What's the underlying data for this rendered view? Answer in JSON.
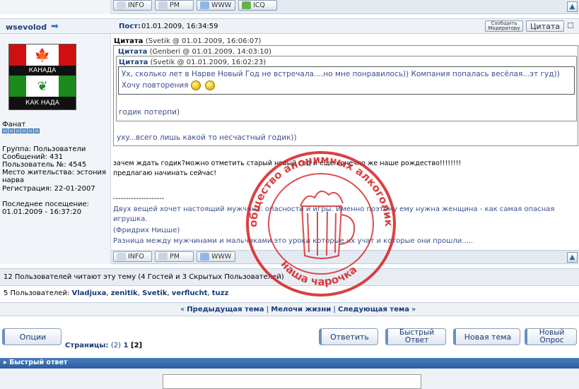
{
  "top_buttons": [
    "INFO",
    "PM",
    "WWW",
    "ICQ"
  ],
  "user": {
    "name": "wsevolod",
    "flag_top": "КАНАДА",
    "flag_bottom": "КАК НАДА",
    "rank": "Фанат",
    "info": [
      "Группа: Пользователи",
      "Сообщений: 431",
      "Пользователь №: 4545",
      "Место жительства: эстония",
      "нарва",
      "Регистрация: 22-01-2007",
      "",
      "Последнее посещение:",
      "01.01.2009 - 16:37:20"
    ]
  },
  "post": {
    "label": "Пост:",
    "date": "01.01.2009, 16:34:59",
    "report": "Сообщить Модератору",
    "quote_btn": "Цитата",
    "q1_head": "Цитата",
    "q1_meta": "(Svetik @ 01.01.2009, 16:06:07)",
    "q2_head": "Цитата",
    "q2_meta": "(Genberi @ 01.01.2009, 14:03:10)",
    "q3_head": "Цитата",
    "q3_meta": "(Svetik @ 01.01.2009, 16:02:23)",
    "q3_line1": "Ух, сколько лет в Нарве Новый Год не встречала....но мне понравилось)) Компания попалась весёлая...эт гуд))",
    "q3_line2": "Хочу повторения",
    "q2_text": "годик потерпи)",
    "q1_text": "ухy...всего лишь какой то несчастный годик))",
    "body1": "зачем ждать годик?можно отметить старый новый год и еще конечно же наше рождество!!!!!!!!",
    "body2": "предлагаю начинать сейчас!",
    "sig_sep": "--------------------",
    "sig1": "Двух вещей хочет настоящий мужчина: опасности и игры. Именно поэтому ему нужна женщина - как самая опасная",
    "sig2": "игрушка.",
    "sig3": "(Фридрих Ницше)",
    "sig4": "Разница между мужчинами и мальчиками это уроки которые их учат и которые они прошли....."
  },
  "bottom_buttons": [
    "INFO",
    "PM",
    "WWW"
  ],
  "stamp": {
    "text": "общество анонимных алкоголиков",
    "bottom": "наша чарочка"
  },
  "readers": "12 Пользователей читают эту тему (4 Гостей и 3 Скрытых Пользователей)",
  "users_label": "5 Пользователей:",
  "users": [
    "Vladjuxa",
    "zenitik",
    "Svetik",
    "verflucht",
    "tuzz"
  ],
  "nav": {
    "prev": "Предыдущая тема",
    "mid": "Мелочи жизни",
    "next": "Следующая тема"
  },
  "options": "Опции",
  "pages_label": "Страницы:",
  "pages_total": "(2)",
  "page1": "1",
  "page2": "[2]",
  "actions": {
    "reply": "Ответить",
    "fast": "Быстрый Ответ",
    "newtopic": "Новая тема",
    "poll": "Новый Опрос"
  },
  "quick_reply": "Быстрый ответ"
}
